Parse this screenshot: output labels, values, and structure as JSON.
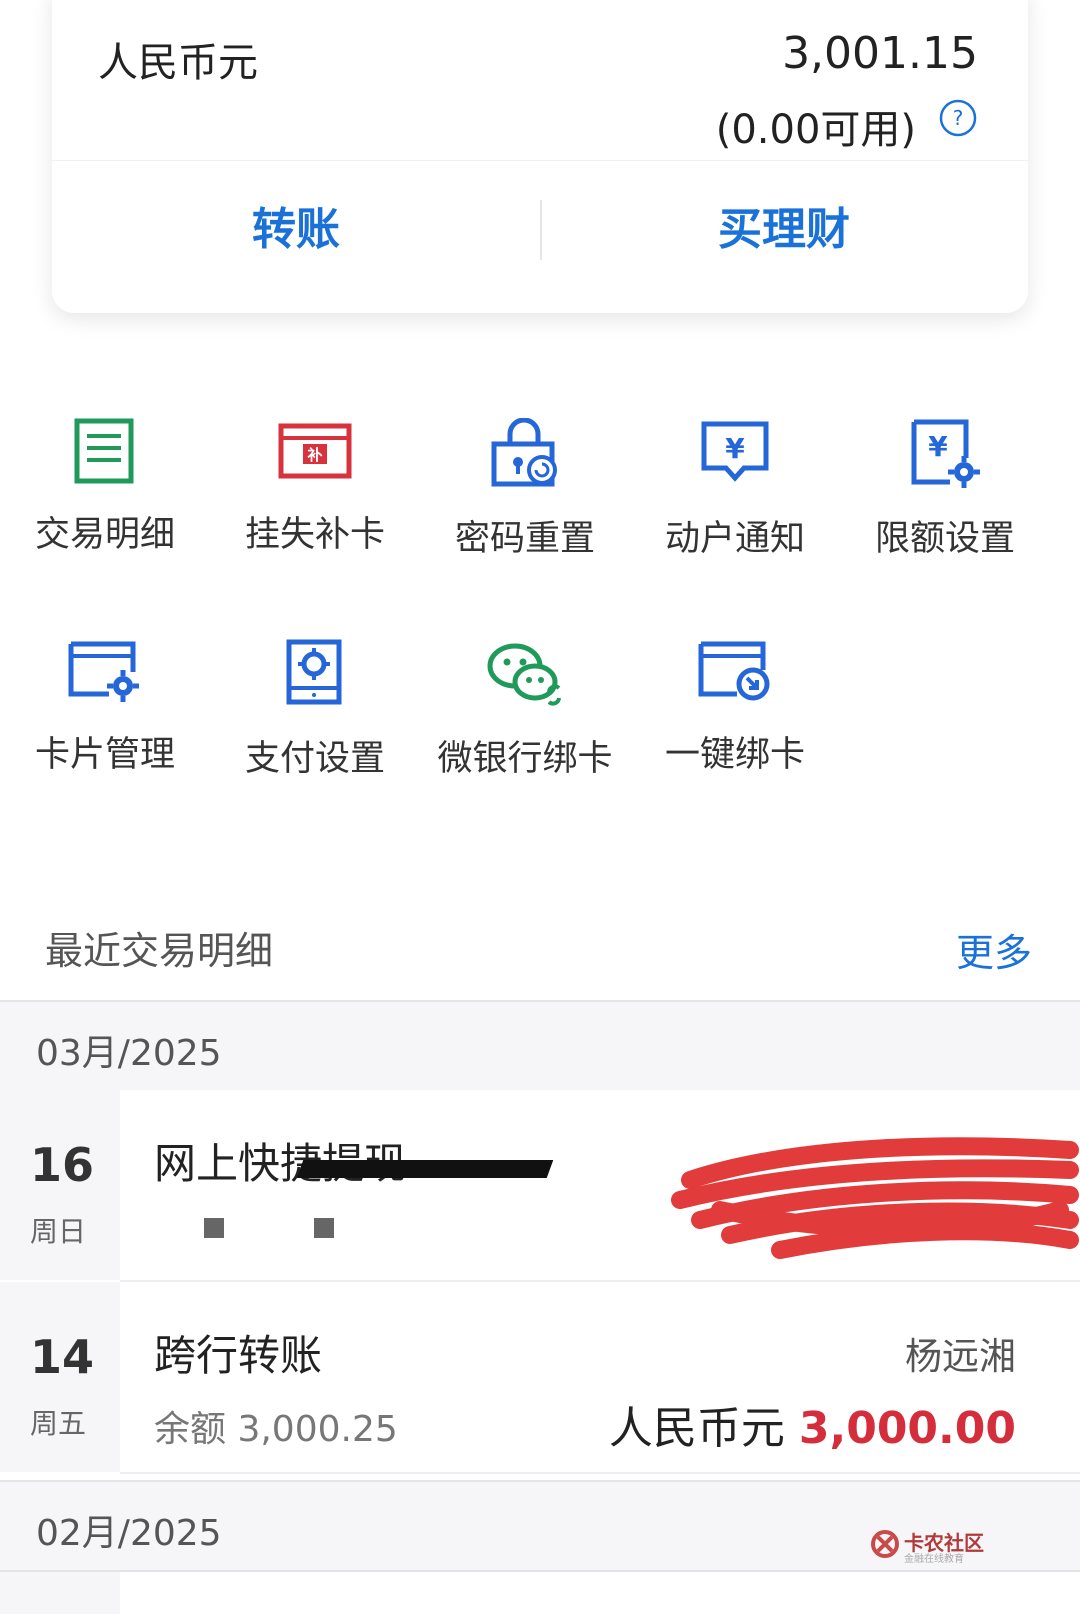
{
  "account": {
    "currency_label": "人民币元",
    "balance": "3,001.15",
    "available": "(0.00可用)"
  },
  "actions": {
    "transfer": "转账",
    "wealth": "买理财"
  },
  "services": [
    {
      "label": "交易明细",
      "icon": "document-list-icon"
    },
    {
      "label": "挂失补卡",
      "icon": "card-replace-icon"
    },
    {
      "label": "密码重置",
      "icon": "lock-reset-icon"
    },
    {
      "label": "动户通知",
      "icon": "yuan-message-icon"
    },
    {
      "label": "限额设置",
      "icon": "yuan-settings-icon"
    },
    {
      "label": "卡片管理",
      "icon": "card-settings-icon"
    },
    {
      "label": "支付设置",
      "icon": "payment-settings-icon"
    },
    {
      "label": "微银行绑卡",
      "icon": "wechat-link-icon"
    },
    {
      "label": "一键绑卡",
      "icon": "card-bind-icon"
    }
  ],
  "recent": {
    "title": "最近交易明细",
    "more": "更多"
  },
  "months": [
    "03月/2025",
    "02月/2025"
  ],
  "transactions": [
    {
      "day": "16",
      "weekday": "周日",
      "title": "网上快捷提现"
    },
    {
      "day": "14",
      "weekday": "周五",
      "title": "跨行转账",
      "balance": "余额 3,000.25",
      "party": "杨远湘",
      "currency": "人民币元",
      "amount": "3,000.00"
    }
  ],
  "watermark": {
    "name": "卡农社区",
    "tagline": "金融在线教育"
  },
  "colors": {
    "accent": "#1a72d9",
    "green": "#1f9a5b",
    "red": "#d42e3c",
    "redact": "#e23b3b"
  }
}
